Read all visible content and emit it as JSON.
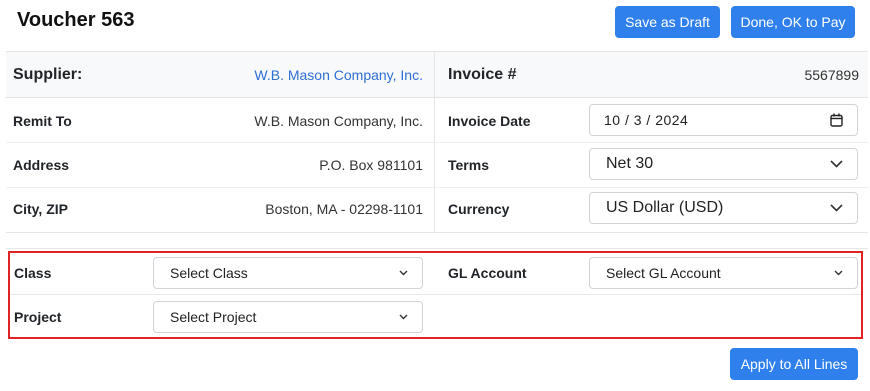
{
  "header": {
    "title": "Voucher 563",
    "save_draft_label": "Save as Draft",
    "done_label": "Done, OK to Pay"
  },
  "supplier": {
    "label": "Supplier:",
    "name": "W.B. Mason Company, Inc.",
    "remit_to_label": "Remit To",
    "remit_to": "W.B. Mason Company, Inc.",
    "address_label": "Address",
    "address": "P.O. Box 981101",
    "city_zip_label": "City, ZIP",
    "city_zip": "Boston, MA - 02298-1101"
  },
  "invoice": {
    "number_label": "Invoice #",
    "number": "5567899",
    "date_label": "Invoice Date",
    "date": "10 / 3 / 2024",
    "terms_label": "Terms",
    "terms": "Net 30",
    "currency_label": "Currency",
    "currency": "US Dollar (USD)"
  },
  "coding": {
    "class_label": "Class",
    "class_placeholder": "Select Class",
    "project_label": "Project",
    "project_placeholder": "Select Project",
    "gl_label": "GL Account",
    "gl_placeholder": "Select GL Account",
    "apply_label": "Apply to All Lines"
  },
  "colors": {
    "accent": "#2f80ed",
    "link": "#2f6fd6",
    "highlight": "#e02424"
  }
}
